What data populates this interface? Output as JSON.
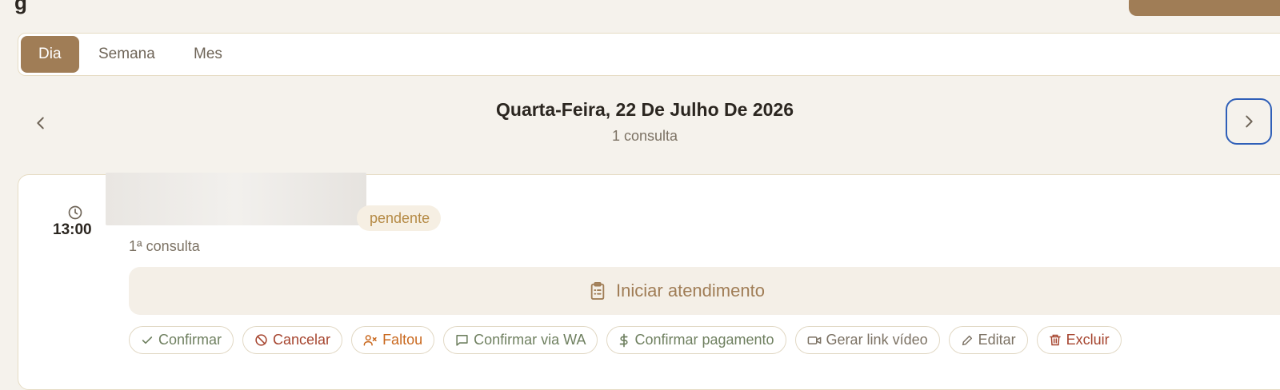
{
  "header": {
    "partial_glyph": "g"
  },
  "tabs": [
    {
      "label": "Dia",
      "active": true
    },
    {
      "label": "Semana",
      "active": false
    },
    {
      "label": "Mes",
      "active": false
    }
  ],
  "date_nav": {
    "title": "Quarta-Feira, 22 De Julho De 2026",
    "subtitle": "1 consulta",
    "prev_icon": "chevron-left-icon",
    "next_icon": "chevron-right-icon"
  },
  "appointment": {
    "time": "13:00",
    "status": "pendente",
    "type": "1ª consulta",
    "start_label": "Iniciar atendimento",
    "start_icon": "clipboard-list-icon",
    "actions": [
      {
        "label": "Confirmar",
        "icon": "check-icon",
        "color": "#6f8060"
      },
      {
        "label": "Cancelar",
        "icon": "ban-icon",
        "color": "#a6452f"
      },
      {
        "label": "Faltou",
        "icon": "user-x-icon",
        "color": "#c9681e"
      },
      {
        "label": "Confirmar via WA",
        "icon": "message-square-icon",
        "color": "#6f8060"
      },
      {
        "label": "Confirmar pagamento",
        "icon": "dollar-sign-icon",
        "color": "#6f8060"
      },
      {
        "label": "Gerar link vídeo",
        "icon": "video-icon",
        "color": "#7c7264"
      },
      {
        "label": "Editar",
        "icon": "pencil-icon",
        "color": "#7c7264"
      },
      {
        "label": "Excluir",
        "icon": "trash-icon",
        "color": "#a6452f"
      }
    ]
  },
  "colors": {
    "brand": "#a07d56",
    "background": "#f5f2ec",
    "focus_ring": "#2f5fb8",
    "pending": "#b58a45"
  }
}
